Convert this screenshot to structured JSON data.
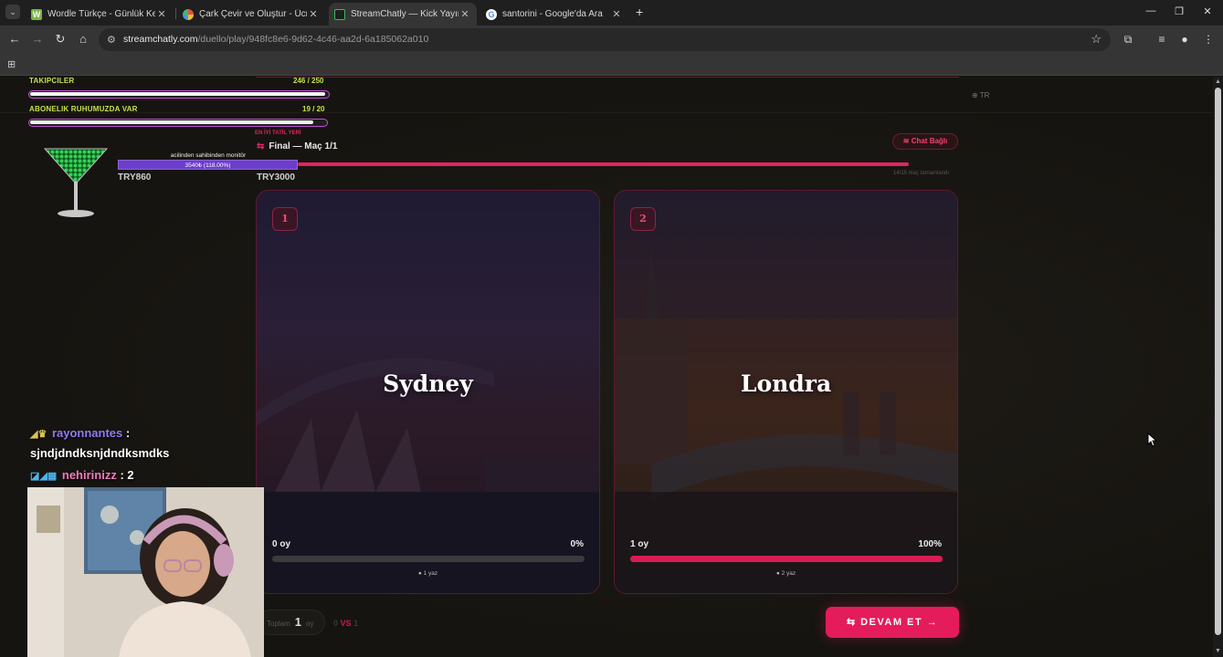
{
  "browser": {
    "tabs": [
      {
        "title": "Wordle Türkçe - Günlük Kelime",
        "favicon_color": "#7ab648",
        "active": false
      },
      {
        "title": "Çark Çevir ve Oluştur - Ücretsiz",
        "favicon_color": "#e8a33c",
        "active": false
      },
      {
        "title": "StreamChatly — Kick Yayıncıları",
        "favicon_color": "#2fbf5f",
        "active": true
      },
      {
        "title": "santorini - Google'da Ara",
        "favicon_color": "#4a8af4",
        "active": false
      }
    ],
    "url_host": "streamchatly.com",
    "url_path": "/duello/play/948fc8e6-9d62-4c46-aa2d-6a185062a010"
  },
  "overlay": {
    "goal1_label": "TAKIPCILER",
    "goal1_count": "246 / 250",
    "goal1_fraction": 0.984,
    "goal2_label": "ABONELIK RUHUMUZDA VAR",
    "goal2_count": "19 / 20",
    "goal2_fraction": 0.95,
    "best_label": "EN İYİ TATİL YERİ",
    "donor_title": "acilinden sahibinden monitör",
    "donor_bar_text": "3540₺ (118.00%)",
    "donor_low": "TRY860",
    "donor_high": "TRY3000"
  },
  "header": {
    "lang": "TR",
    "match_title": "Final — Maç 1/1",
    "chat_status": "Chat Bağlı",
    "progress_fraction": 1.0,
    "progress_note": "14/15 maç tamamlandı"
  },
  "cards": [
    {
      "num": "1",
      "city": "Sydney",
      "votes": "0 oy",
      "pct": "0%",
      "pct_value": 0,
      "msgs": "1 yaz"
    },
    {
      "num": "2",
      "city": "Londra",
      "votes": "1 oy",
      "pct": "100%",
      "pct_value": 100,
      "msgs": "2 yaz"
    }
  ],
  "footer": {
    "total_label": "Toplam",
    "total_value": "1",
    "total_unit": "oy",
    "vs_left": "0",
    "vs_label": "VS",
    "vs_right": "1",
    "continue_label": "DEVAM ET"
  },
  "stream_chat": {
    "line1_user": "rayonnantes",
    "line1_msg": "sjndjdndksnjdndksmdks",
    "line2_user": "nehirinizz",
    "line2_msg": ": 2",
    "sep": ":"
  }
}
